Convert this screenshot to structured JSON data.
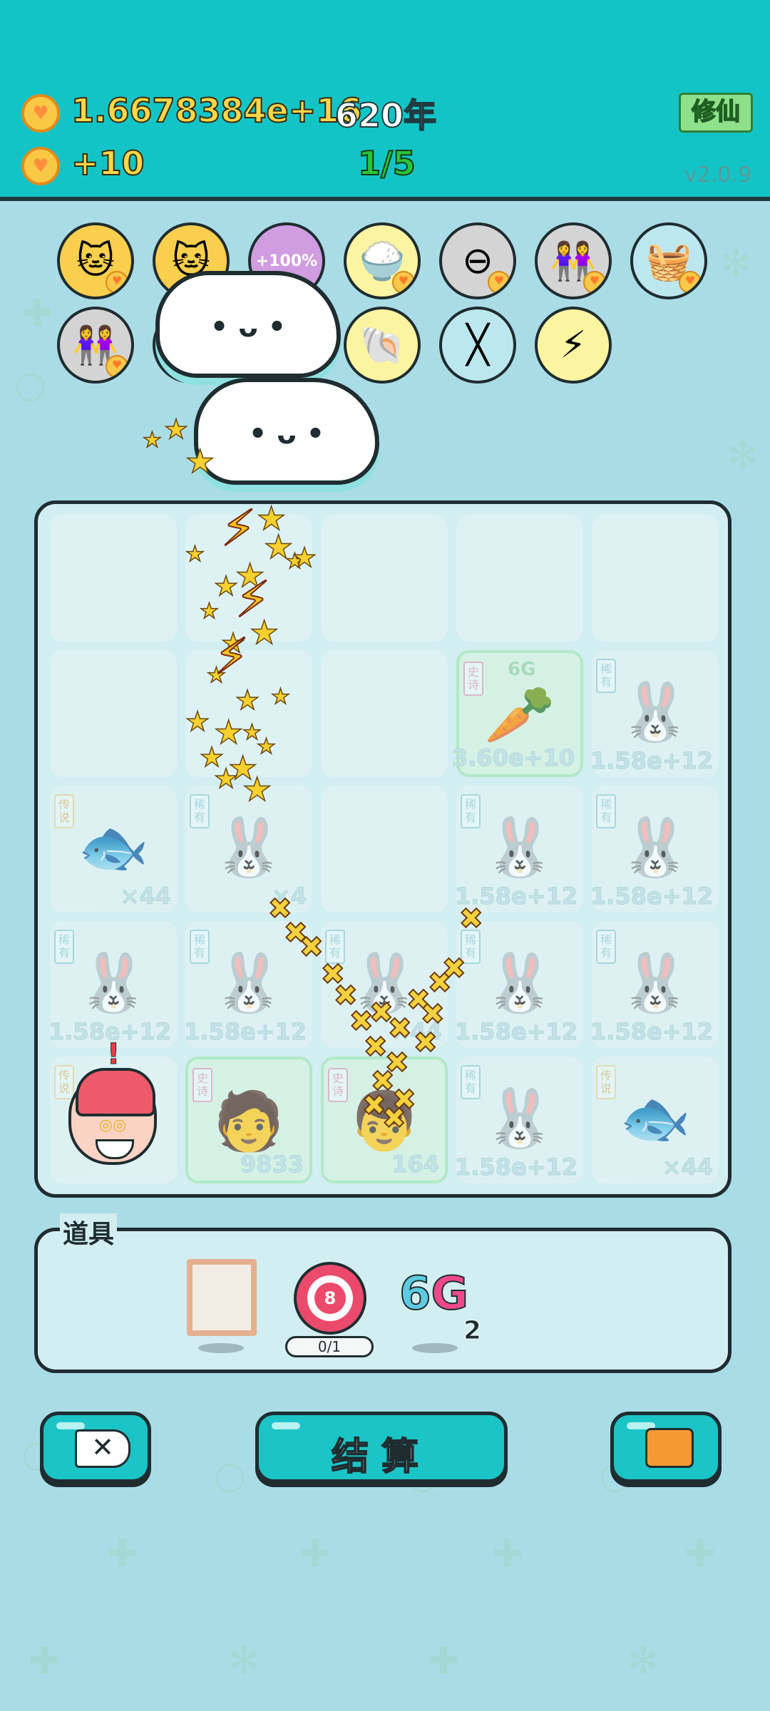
{
  "header": {
    "coins": "1.6678384e+16",
    "year": "620年",
    "income": "+10",
    "progress": "1/5",
    "xiuxian_label": "修仙",
    "version": "v2.0.9"
  },
  "skills": [
    {
      "icon": "cat-scratch-icon",
      "glyph": "🐱",
      "bg": "#f9cf4d",
      "heart": true
    },
    {
      "icon": "cat-scratch-icon",
      "glyph": "🐱",
      "bg": "#f9cf4d",
      "heart": false
    },
    {
      "icon": "boost-percent-icon",
      "glyph": "+100%",
      "bg": "#cf9de0",
      "heart": false
    },
    {
      "icon": "rice-bowl-icon",
      "glyph": "🍚",
      "bg": "#fbf4a0",
      "heart": true
    },
    {
      "icon": "minus-circle-icon",
      "glyph": "⊖",
      "bg": "#d4d4d4",
      "heart": true
    },
    {
      "icon": "twin-girls-icon",
      "glyph": "👭",
      "bg": "#d4d4d4",
      "heart": true
    },
    {
      "icon": "fruit-basket-icon",
      "glyph": "🧺",
      "bg": "#bde7ef",
      "heart": true
    },
    {
      "icon": "twin-girls-icon",
      "glyph": "👭",
      "bg": "#d4d4d4",
      "heart": true
    },
    {
      "icon": "fish-tank-icon",
      "glyph": "🐠",
      "bg": "#9fe0ee",
      "heart": false
    },
    {
      "icon": "arrow-up-icon",
      "glyph": "↗",
      "bg": "#d4d4d4",
      "heart": false
    },
    {
      "icon": "shell-icon",
      "glyph": "🐚",
      "bg": "#fbf4a0",
      "heart": false
    },
    {
      "icon": "chopsticks-icon",
      "glyph": "╳",
      "bg": "#bde7ef",
      "heart": false
    },
    {
      "icon": "lightning-icon",
      "glyph": "⚡",
      "bg": "#fbf4a0",
      "heart": false
    }
  ],
  "board": [
    {
      "tag": "",
      "art": "",
      "value": "",
      "grade": ""
    },
    {
      "tag": "",
      "art": "",
      "value": "",
      "grade": ""
    },
    {
      "tag": "",
      "art": "",
      "value": "",
      "grade": ""
    },
    {
      "tag": "",
      "art": "",
      "value": "",
      "grade": ""
    },
    {
      "tag": "",
      "art": "",
      "value": "",
      "grade": ""
    },
    {
      "tag": "",
      "art": "",
      "value": "",
      "grade": ""
    },
    {
      "tag": "",
      "art": "",
      "value": "",
      "grade": ""
    },
    {
      "tag": "",
      "art": "",
      "value": "",
      "grade": ""
    },
    {
      "tag": "史诗",
      "tagColor": "red",
      "art": "🥕",
      "value": "3.60e+10",
      "grade": "6G",
      "green": true
    },
    {
      "tag": "稀有",
      "art": "🐰",
      "value": "1.58e+12",
      "grade": ""
    },
    {
      "tag": "传说",
      "tagColor": "gold",
      "art": "🐟",
      "value": "×44",
      "grade": ""
    },
    {
      "tag": "稀有",
      "art": "🐰",
      "value": "×4",
      "grade": ""
    },
    {
      "tag": "",
      "art": "",
      "value": "",
      "grade": ""
    },
    {
      "tag": "稀有",
      "art": "🐰",
      "value": "1.58e+12",
      "grade": ""
    },
    {
      "tag": "稀有",
      "art": "🐰",
      "value": "1.58e+12",
      "grade": ""
    },
    {
      "tag": "稀有",
      "art": "🐰",
      "value": "1.58e+12",
      "grade": ""
    },
    {
      "tag": "稀有",
      "art": "🐰",
      "value": "1.58e+12",
      "grade": ""
    },
    {
      "tag": "稀有",
      "art": "🐰",
      "value": "×44",
      "grade": ""
    },
    {
      "tag": "稀有",
      "art": "🐰",
      "value": "1.58e+12",
      "grade": ""
    },
    {
      "tag": "稀有",
      "art": "🐰",
      "value": "1.58e+12",
      "grade": ""
    },
    {
      "tag": "传说",
      "tagColor": "gold",
      "art": "",
      "value": "",
      "grade": ""
    },
    {
      "tag": "史诗",
      "tagColor": "red",
      "art": "🧑",
      "value": "9833",
      "grade": "",
      "green": true
    },
    {
      "tag": "史诗",
      "tagColor": "red",
      "art": "👦",
      "value": "164",
      "grade": "",
      "green": true
    },
    {
      "tag": "稀有",
      "art": "🐰",
      "value": "1.58e+12",
      "grade": ""
    },
    {
      "tag": "传说",
      "tagColor": "gold",
      "art": "🐟",
      "value": "×44",
      "grade": ""
    }
  ],
  "props": {
    "label": "道具",
    "target_number": "8",
    "target_progress": "0/1",
    "sixg_six": "6",
    "sixg_g": "G",
    "sixg_count": "2"
  },
  "actions": {
    "settle_label": "结算"
  }
}
